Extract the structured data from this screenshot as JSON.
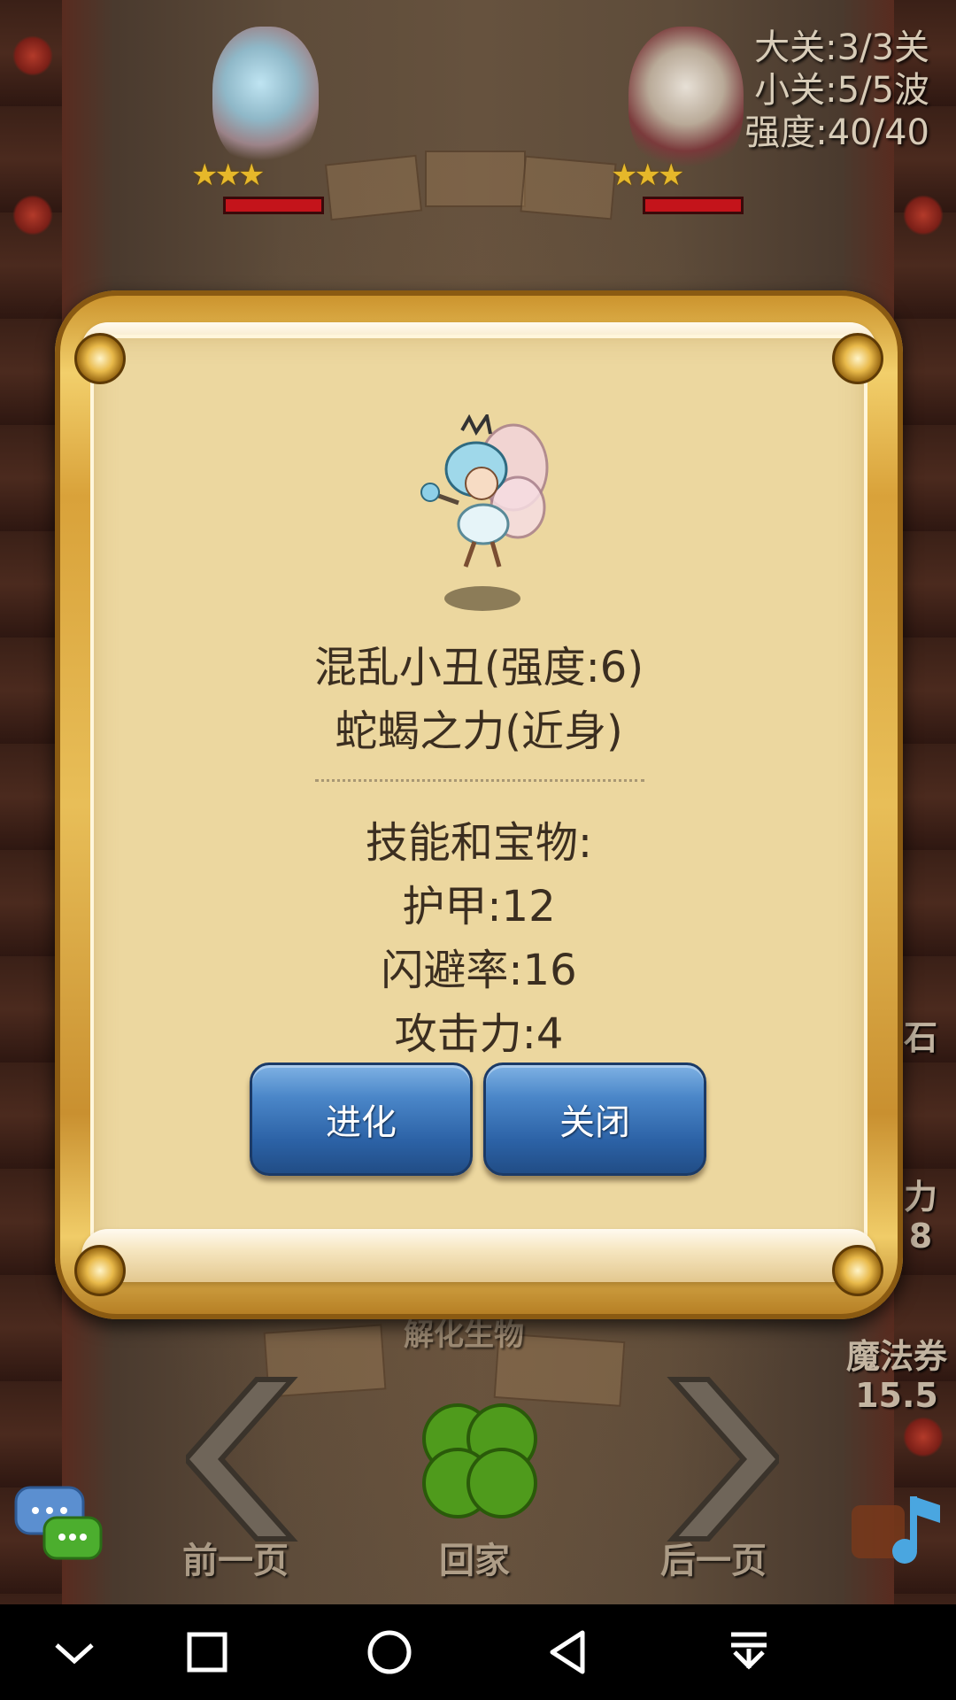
{
  "stage_info": {
    "big_stage": "大关:3/3关",
    "small_stage": "小关:5/5波",
    "strength": "强度:40/40"
  },
  "top_units": [
    {
      "name": "fairy",
      "stars": "★★★"
    },
    {
      "name": "goblin",
      "stars": "★★★"
    }
  ],
  "side_badges": {
    "right_partial_1": "石",
    "right_partial_2": "力\n8",
    "magic_ticket_label": "魔法券",
    "magic_ticket_value": "15.5",
    "behind_dialog_label": "解化生物"
  },
  "bottom_nav": {
    "prev": "前一页",
    "home": "回家",
    "next": "后一页"
  },
  "dialog": {
    "unit_title": "混乱小丑(强度:6)",
    "unit_subtitle": "蛇蝎之力(近身)",
    "section_header": "技能和宝物:",
    "stats": [
      "护甲:12",
      "闪避率:16",
      "攻击力:4"
    ],
    "buttons": {
      "evolve": "进化",
      "close": "关闭"
    }
  },
  "colors": {
    "button_blue": "#2c62a6",
    "parchment": "#ecd79f",
    "frame_gold": "#d9a23a",
    "text_dark": "#3b2e20"
  },
  "icons": {
    "system_nav": [
      "chevron-down-icon",
      "square-icon",
      "circle-icon",
      "triangle-back-icon",
      "pull-down-icon"
    ],
    "chat": "chat-bubbles-icon"
  }
}
